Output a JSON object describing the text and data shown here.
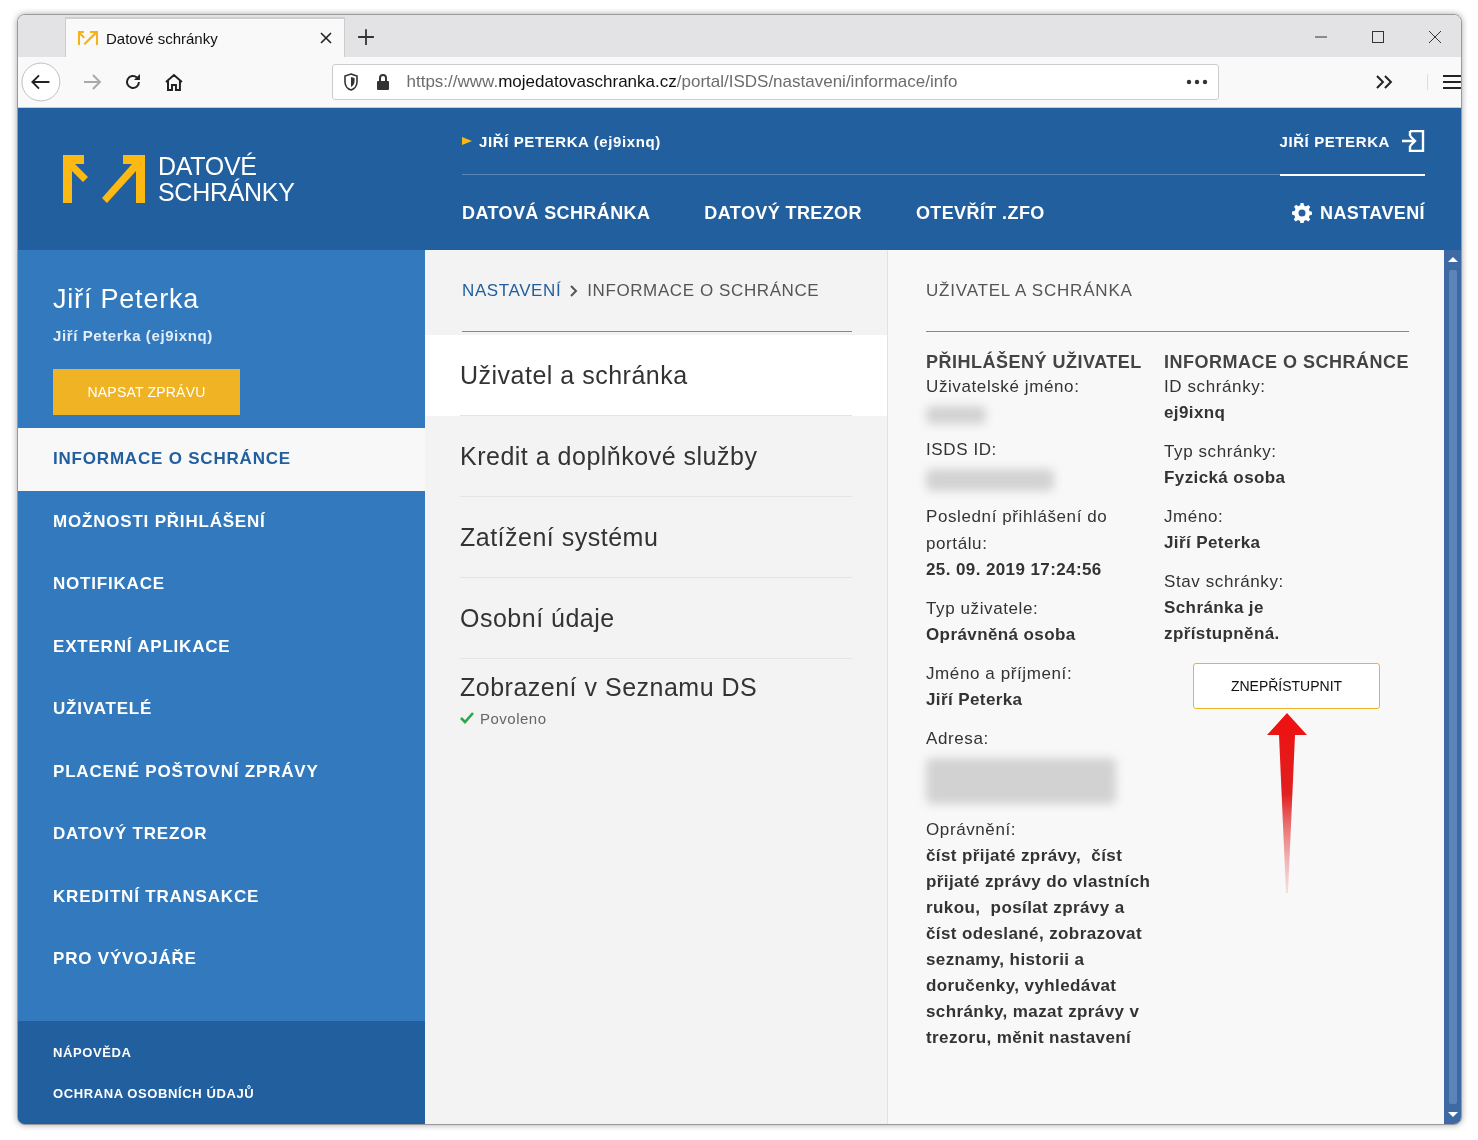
{
  "browser": {
    "tab_title": "Datové schránky",
    "url_host_prefix": "https://www.",
    "url_domain": "mojedatovaschranka.cz",
    "url_path": "/portal/ISDS/nastaveni/informace/info"
  },
  "header": {
    "logo_line1": "DATOVÉ",
    "logo_line2": "SCHRÁNKY",
    "account_link": "JIŘÍ PETERKA (ej9ixnq)",
    "logout_label": "JIŘÍ PETERKA",
    "nav": [
      {
        "label": "DATOVÁ SCHRÁNKA",
        "selected": false
      },
      {
        "label": "DATOVÝ TREZOR",
        "selected": false
      },
      {
        "label": "OTEVŘÍT .ZFO",
        "selected": false
      }
    ],
    "settings": {
      "label": "NASTAVENÍ",
      "selected": true
    }
  },
  "sidebar": {
    "name": "Jiří Peterka",
    "subtitle": "Jiří Peterka (ej9ixnq)",
    "compose_button": "NAPSAT ZPRÁVU",
    "items": [
      {
        "label": "INFORMACE O SCHRÁNCE",
        "selected": true
      },
      {
        "label": "MOŽNOSTI PŘIHLÁŠENÍ",
        "selected": false
      },
      {
        "label": "NOTIFIKACE",
        "selected": false
      },
      {
        "label": "EXTERNÍ APLIKACE",
        "selected": false
      },
      {
        "label": "UŽIVATELÉ",
        "selected": false
      },
      {
        "label": "PLACENÉ POŠTOVNÍ ZPRÁVY",
        "selected": false
      },
      {
        "label": "DATOVÝ TREZOR",
        "selected": false
      },
      {
        "label": "KREDITNÍ TRANSAKCE",
        "selected": false
      },
      {
        "label": "PRO VÝVOJÁŘE",
        "selected": false
      }
    ],
    "footer_links": [
      "NÁPOVĚDA",
      "OCHRANA OSOBNÍCH ÚDAJŮ"
    ]
  },
  "breadcrumb": {
    "parent": "NASTAVENÍ",
    "current": "INFORMACE O SCHRÁNCE"
  },
  "sections": [
    {
      "label": "Uživatel a schránka",
      "selected": true
    },
    {
      "label": "Kredit a doplňkové služby",
      "selected": false
    },
    {
      "label": "Zatížení systému",
      "selected": false
    },
    {
      "label": "Osobní údaje",
      "selected": false
    },
    {
      "label": "Zobrazení v Seznamu DS",
      "selected": false,
      "status": "Povoleno"
    }
  ],
  "detail": {
    "title": "UŽIVATEL A SCHRÁNKA",
    "columns": [
      {
        "heading": "PŘIHLÁŠENÝ UŽIVATEL",
        "fields": [
          {
            "label": "Uživatelské jméno:",
            "kind": "blurred"
          },
          {
            "label": "ISDS ID:",
            "kind": "blurred_wide"
          },
          {
            "label": "Poslední přihlášení do portálu:",
            "kind": "text",
            "value": "25. 09. 2019 17:24:56"
          },
          {
            "label": "Typ uživatele:",
            "kind": "text",
            "value": "Oprávněná osoba"
          },
          {
            "label": "Jméno a příjmení:",
            "kind": "text",
            "value": "Jiří Peterka"
          },
          {
            "label": "Adresa:",
            "kind": "blurred_block"
          },
          {
            "label": "Oprávnění:",
            "kind": "text",
            "value": "číst přijaté zprávy,  číst přijaté zprávy do vlastních rukou,  posílat zprávy a číst odeslané, zobrazovat seznamy, historii a doručenky, vyhledávat schránky, mazat zprávy v trezoru, měnit nastavení"
          }
        ]
      },
      {
        "heading": "INFORMACE O SCHRÁNCE",
        "fields": [
          {
            "label": "ID schránky:",
            "kind": "text",
            "value": "ej9ixnq"
          },
          {
            "label": "Typ schránky:",
            "kind": "text",
            "value": "Fyzická osoba"
          },
          {
            "label": "Jméno:",
            "kind": "text",
            "value": "Jiří Peterka"
          },
          {
            "label": "Stav schránky:",
            "kind": "text",
            "value": "Schránka je zpřístupněná."
          }
        ],
        "button": "ZNEPŘÍSTUPNIT"
      }
    ]
  },
  "annotation": {
    "kind": "arrow"
  }
}
